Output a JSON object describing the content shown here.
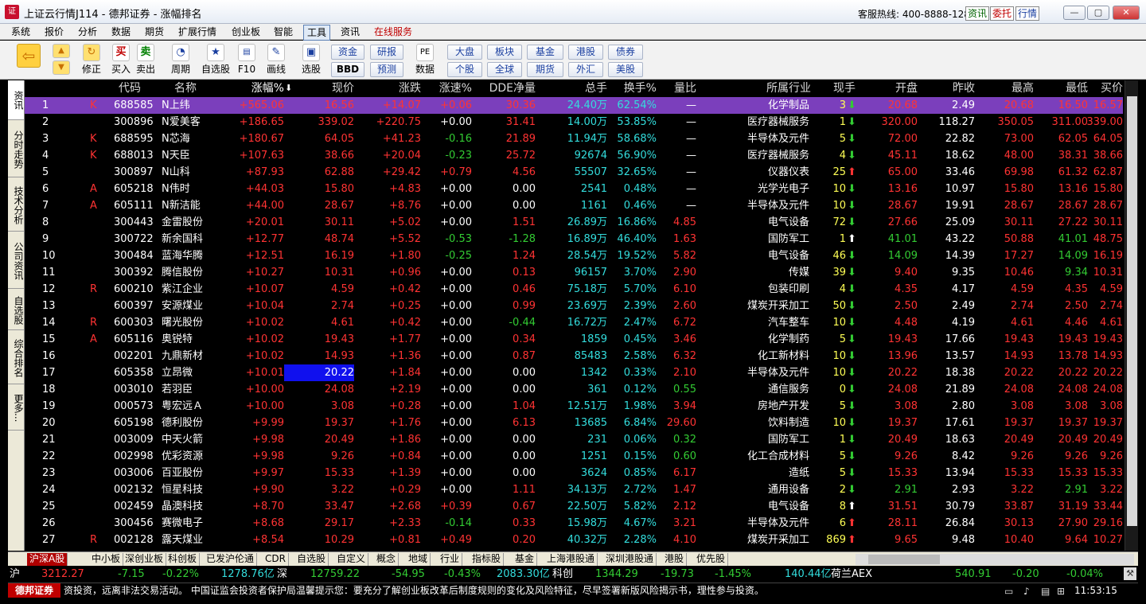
{
  "window": {
    "title": "上证云行情J114 - 德邦证券 - 涨幅排名",
    "hotline": "客服热线: 400-8888-128",
    "btn_news": "资讯",
    "btn_order": "委托",
    "btn_quote": "行情",
    "min": "—",
    "max": "▢",
    "close": "✕"
  },
  "menu": [
    "系统",
    "报价",
    "分析",
    "数据",
    "期货",
    "扩展行情",
    "创业板",
    "智能",
    "工具",
    "资讯",
    "在线服务"
  ],
  "toolbar": {
    "buy": "买入",
    "sell": "卖出",
    "revise": "修正",
    "period": "周期",
    "watch": "自选股",
    "f10": "F10",
    "draw": "画线",
    "pick": "选股",
    "data": "数据",
    "b_zijin": "资金",
    "b_bbd": "BBD",
    "b_yanbao": "研报",
    "b_yuce": "预测",
    "b_dapan": "大盘",
    "b_gegu": "个股",
    "b_bankuai": "板块",
    "b_quanqiu": "全球",
    "b_jijin": "基金",
    "b_qihuo": "期货",
    "b_ganggu": "港股",
    "b_waihui": "外汇",
    "b_zhaiquan": "债券",
    "b_meigu": "美股",
    "pe": "PE"
  },
  "sidebar": [
    "资讯",
    "分时走势",
    "技术分析",
    "公司资讯",
    "自选股",
    "综合排名",
    "更多..."
  ],
  "headers": {
    "code": "代码",
    "name": "名称",
    "pct": "涨幅%",
    "price": "现价",
    "chg": "涨跌",
    "speed": "涨速%",
    "dde": "DDE净量",
    "vol": "总手",
    "turn": "换手%",
    "ratio": "量比",
    "industry": "所属行业",
    "now": "现手",
    "open": "开盘",
    "prev": "昨收",
    "high": "最高",
    "low": "最低",
    "bid": "买价"
  },
  "rows": [
    [
      "1",
      "K",
      "688585",
      "N上纬",
      "+565.06",
      "16.56",
      "+14.07",
      "+0.06",
      "30.36",
      "24.40万",
      "62.54%",
      "—",
      "化学制品",
      "3",
      "d",
      "20.68",
      "2.49",
      "20.68",
      "16.50",
      "16.57"
    ],
    [
      "2",
      "",
      "300896",
      "N爱美客",
      "+186.65",
      "339.02",
      "+220.75",
      "+0.00",
      "31.41",
      "14.00万",
      "53.85%",
      "—",
      "医疗器械服务",
      "1",
      "d",
      "320.00",
      "118.27",
      "350.05",
      "311.00",
      "339.00"
    ],
    [
      "3",
      "K",
      "688595",
      "N芯海",
      "+180.67",
      "64.05",
      "+41.23",
      "-0.16",
      "21.89",
      "11.94万",
      "58.68%",
      "—",
      "半导体及元件",
      "5",
      "d",
      "72.00",
      "22.82",
      "73.00",
      "62.05",
      "64.05"
    ],
    [
      "4",
      "K",
      "688013",
      "N天臣",
      "+107.63",
      "38.66",
      "+20.04",
      "-0.23",
      "25.72",
      "92674",
      "56.90%",
      "—",
      "医疗器械服务",
      "4",
      "d",
      "45.11",
      "18.62",
      "48.00",
      "38.31",
      "38.66"
    ],
    [
      "5",
      "",
      "300897",
      "N山科",
      "+87.93",
      "62.88",
      "+29.42",
      "+0.79",
      "4.56",
      "55507",
      "32.65%",
      "—",
      "仪器仪表",
      "25",
      "u",
      "65.00",
      "33.46",
      "69.98",
      "61.32",
      "62.87"
    ],
    [
      "6",
      "A",
      "605218",
      "N伟时",
      "+44.03",
      "15.80",
      "+4.83",
      "+0.00",
      "0.00",
      "2541",
      "0.48%",
      "—",
      "光学光电子",
      "10",
      "d",
      "13.16",
      "10.97",
      "15.80",
      "13.16",
      "15.80"
    ],
    [
      "7",
      "A",
      "605111",
      "N新洁能",
      "+44.00",
      "28.67",
      "+8.76",
      "+0.00",
      "0.00",
      "1161",
      "0.46%",
      "—",
      "半导体及元件",
      "10",
      "d",
      "28.67",
      "19.91",
      "28.67",
      "28.67",
      "28.67"
    ],
    [
      "8",
      "",
      "300443",
      "金雷股份",
      "+20.01",
      "30.11",
      "+5.02",
      "+0.00",
      "1.51",
      "26.89万",
      "16.86%",
      "4.85",
      "电气设备",
      "72",
      "d",
      "27.66",
      "25.09",
      "30.11",
      "27.22",
      "30.11"
    ],
    [
      "9",
      "",
      "300722",
      "新余国科",
      "+12.77",
      "48.74",
      "+5.52",
      "-0.53",
      "-1.28",
      "16.89万",
      "46.40%",
      "1.63",
      "国防军工",
      "1",
      "w",
      "41.01",
      "43.22",
      "50.88",
      "41.01",
      "48.75"
    ],
    [
      "10",
      "",
      "300484",
      "蓝海华腾",
      "+12.51",
      "16.19",
      "+1.80",
      "-0.25",
      "1.24",
      "28.54万",
      "19.52%",
      "5.82",
      "电气设备",
      "46",
      "d",
      "14.09",
      "14.39",
      "17.27",
      "14.09",
      "16.19"
    ],
    [
      "11",
      "",
      "300392",
      "腾信股份",
      "+10.27",
      "10.31",
      "+0.96",
      "+0.00",
      "0.13",
      "96157",
      "3.70%",
      "2.90",
      "传媒",
      "39",
      "d",
      "9.40",
      "9.35",
      "10.46",
      "9.34",
      "10.31"
    ],
    [
      "12",
      "R",
      "600210",
      "紫江企业",
      "+10.07",
      "4.59",
      "+0.42",
      "+0.00",
      "0.46",
      "75.18万",
      "5.70%",
      "6.10",
      "包装印刷",
      "4",
      "d",
      "4.35",
      "4.17",
      "4.59",
      "4.35",
      "4.59"
    ],
    [
      "13",
      "",
      "600397",
      "安源煤业",
      "+10.04",
      "2.74",
      "+0.25",
      "+0.00",
      "0.99",
      "23.69万",
      "2.39%",
      "2.60",
      "煤炭开采加工",
      "50",
      "d",
      "2.50",
      "2.49",
      "2.74",
      "2.50",
      "2.74"
    ],
    [
      "14",
      "R",
      "600303",
      "曙光股份",
      "+10.02",
      "4.61",
      "+0.42",
      "+0.00",
      "-0.44",
      "16.72万",
      "2.47%",
      "6.72",
      "汽车整车",
      "10",
      "d",
      "4.48",
      "4.19",
      "4.61",
      "4.46",
      "4.61"
    ],
    [
      "15",
      "A",
      "605116",
      "奥锐特",
      "+10.02",
      "19.43",
      "+1.77",
      "+0.00",
      "0.34",
      "1859",
      "0.45%",
      "3.46",
      "化学制药",
      "5",
      "d",
      "19.43",
      "17.66",
      "19.43",
      "19.43",
      "19.43"
    ],
    [
      "16",
      "",
      "002201",
      "九鼎新材",
      "+10.02",
      "14.93",
      "+1.36",
      "+0.00",
      "0.87",
      "85483",
      "2.58%",
      "6.32",
      "化工新材料",
      "10",
      "d",
      "13.96",
      "13.57",
      "14.93",
      "13.78",
      "14.93"
    ],
    [
      "17",
      "",
      "605358",
      "立昂微",
      "+10.01",
      "20.22",
      "+1.84",
      "+0.00",
      "0.00",
      "1342",
      "0.33%",
      "2.10",
      "半导体及元件",
      "10",
      "d",
      "20.22",
      "18.38",
      "20.22",
      "20.22",
      "20.22"
    ],
    [
      "18",
      "",
      "003010",
      "若羽臣",
      "+10.00",
      "24.08",
      "+2.19",
      "+0.00",
      "0.00",
      "361",
      "0.12%",
      "0.55",
      "通信服务",
      "0",
      "d",
      "24.08",
      "21.89",
      "24.08",
      "24.08",
      "24.08"
    ],
    [
      "19",
      "",
      "000573",
      "粤宏远Ａ",
      "+10.00",
      "3.08",
      "+0.28",
      "+0.00",
      "1.04",
      "12.51万",
      "1.98%",
      "3.94",
      "房地产开发",
      "5",
      "d",
      "3.08",
      "2.80",
      "3.08",
      "3.08",
      "3.08"
    ],
    [
      "20",
      "",
      "605198",
      "德利股份",
      "+9.99",
      "19.37",
      "+1.76",
      "+0.00",
      "6.13",
      "13685",
      "6.84%",
      "29.60",
      "饮料制造",
      "10",
      "d",
      "19.37",
      "17.61",
      "19.37",
      "19.37",
      "19.37"
    ],
    [
      "21",
      "",
      "003009",
      "中天火箭",
      "+9.98",
      "20.49",
      "+1.86",
      "+0.00",
      "0.00",
      "231",
      "0.06%",
      "0.32",
      "国防军工",
      "1",
      "d",
      "20.49",
      "18.63",
      "20.49",
      "20.49",
      "20.49"
    ],
    [
      "22",
      "",
      "002998",
      "优彩资源",
      "+9.98",
      "9.26",
      "+0.84",
      "+0.00",
      "0.00",
      "1251",
      "0.15%",
      "0.60",
      "化工合成材料",
      "5",
      "d",
      "9.26",
      "8.42",
      "9.26",
      "9.26",
      "9.26"
    ],
    [
      "23",
      "",
      "003006",
      "百亚股份",
      "+9.97",
      "15.33",
      "+1.39",
      "+0.00",
      "0.00",
      "3624",
      "0.85%",
      "6.17",
      "造纸",
      "5",
      "d",
      "15.33",
      "13.94",
      "15.33",
      "15.33",
      "15.33"
    ],
    [
      "24",
      "",
      "002132",
      "恒星科技",
      "+9.90",
      "3.22",
      "+0.29",
      "+0.00",
      "1.11",
      "34.13万",
      "2.72%",
      "1.47",
      "通用设备",
      "2",
      "d",
      "2.91",
      "2.93",
      "3.22",
      "2.91",
      "3.22"
    ],
    [
      "25",
      "",
      "002459",
      "晶澳科技",
      "+8.70",
      "33.47",
      "+2.68",
      "+0.39",
      "0.67",
      "22.50万",
      "5.82%",
      "2.12",
      "电气设备",
      "8",
      "w",
      "31.51",
      "30.79",
      "33.87",
      "31.19",
      "33.44"
    ],
    [
      "26",
      "",
      "300456",
      "赛微电子",
      "+8.68",
      "29.17",
      "+2.33",
      "-0.14",
      "0.33",
      "15.98万",
      "4.67%",
      "3.21",
      "半导体及元件",
      "6",
      "u",
      "28.11",
      "26.84",
      "30.13",
      "27.90",
      "29.16"
    ],
    [
      "27",
      "R",
      "002128",
      "露天煤业",
      "+8.54",
      "10.29",
      "+0.81",
      "+0.49",
      "0.20",
      "40.32万",
      "2.28%",
      "4.10",
      "煤炭开采加工",
      "869",
      "u",
      "9.65",
      "9.48",
      "10.40",
      "9.64",
      "10.27"
    ]
  ],
  "tabs": [
    "沪深A股",
    "中小板",
    "深创业板",
    "科创板",
    "已发沪伦通",
    "CDR",
    "自选股",
    "自定义",
    "概念",
    "地域",
    "行业",
    "指标股",
    "基金",
    "上海港股通",
    "深圳港股通",
    "港股",
    "优先股"
  ],
  "index": {
    "sh_label": "沪",
    "sh_val": "3212.27",
    "sh_chg": "-7.15",
    "sh_pct": "-0.22%",
    "sh_amt": "1278.76亿",
    "sz_label": "深",
    "sz_val": "12759.22",
    "sz_chg": "-54.95",
    "sz_pct": "-0.43%",
    "sz_amt": "2083.30亿",
    "kc_label": "科创",
    "kc_val": "1344.29",
    "kc_chg": "-19.73",
    "kc_pct": "-1.45%",
    "kc_amt": "140.44亿",
    "aex_label": "荷兰AEX",
    "aex_val": "540.91",
    "aex_chg": "-0.20",
    "aex_pct": "-0.04%"
  },
  "news": {
    "brand": "德邦证券",
    "text": "资投资，远离非法交易活动。  中国证监会投资者保护局温馨提示您：要充分了解创业板改革后制度规则的变化及风险特征，尽早签署新版风险揭示书，理性参与投资。",
    "time": "11:53:15"
  },
  "colors": {
    "up": "#ff3333",
    "down": "#33cc33",
    "selected": "#7b3fbc",
    "brand": "#c00000"
  }
}
